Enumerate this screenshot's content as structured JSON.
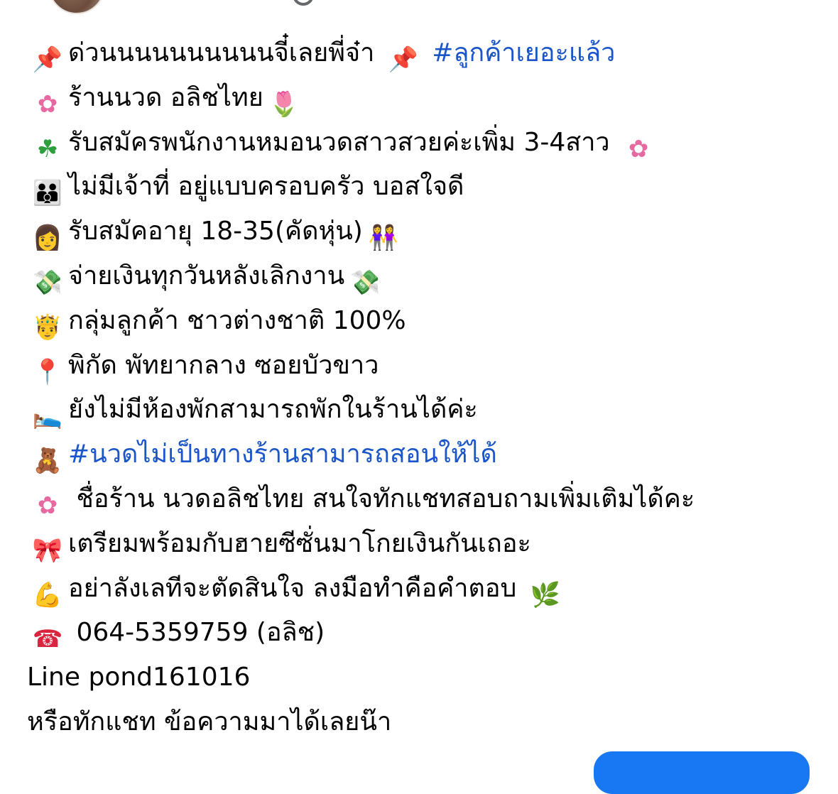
{
  "post": {
    "lines": [
      {
        "icon": "pushpin-icon",
        "glyph": "📌",
        "text": "ด่วนนนนนนนนนนจี๋เลยพี่จ๋า ",
        "icon2": "pushpin-icon",
        "glyph2": "📌",
        "hashtag": "#ลูกค้าเยอะแล้ว"
      },
      {
        "icon": "lotus-icon",
        "glyph": "✿",
        "text": "ร้านนวด อลิชไทย",
        "icon2": "tulip-icon",
        "glyph2": "🌷"
      },
      {
        "icon": "four-leaf-clover-icon",
        "glyph": "☘",
        "text": "รับสมัครพนักงานหมอนวดสาวสวยค่ะเพิ่ม 3-4สาว  ",
        "icon2": "lotus-icon",
        "glyph2": "✿"
      },
      {
        "icon": "family-icon",
        "glyph": "👪",
        "text": "ไม่มีเจ้าที่ อยู่แบบครอบครัว บอสใจดี"
      },
      {
        "icon": "woman-icon",
        "glyph": "👩",
        "text": "รับสมัคอายุ 18-35(คัดหุ่น)",
        "icon2": "two-women-icon",
        "glyph2": "👭"
      },
      {
        "icon": "money-wings-icon",
        "glyph": "💸",
        "text": "จ่ายเงินทุกวันหลังเลิกงาน",
        "icon2": "money-wings-icon",
        "glyph2": "💸"
      },
      {
        "icon": "prince-icon",
        "glyph": "🤴",
        "text": "กลุ่มลูกค้า ชาวต่างชาติ 100%"
      },
      {
        "icon": "round-pushpin-icon",
        "glyph": "📍",
        "text": "พิกัด พัทยากลาง ซอยบัวขาว"
      },
      {
        "icon": "bed-icon",
        "glyph": "🛌",
        "text": "ยังไม่มีห้องพักสามารถพักในร้านได้ค่ะ"
      },
      {
        "icon": "teddy-bear-icon",
        "glyph": "🧸",
        "hashtag": "#นวดไม่เป็นทางร้านสามารถสอนให้ได้"
      },
      {
        "icon": "lotus-icon",
        "glyph": "✿",
        "text": " ชื่อร้าน นวดอลิชไทย สนใจทักแชทสอบถามเพิ่มเติมได้คะ"
      },
      {
        "icon": "ribbon-icon",
        "glyph": "🎀",
        "text": "เตรียมพร้อมกับฮายซีซั่นมาโกยเงินกันเถอะ"
      },
      {
        "icon": "flexed-biceps-icon",
        "glyph": "💪",
        "text": "อย่าลังเลทีจะตัดสินใจ ลงมือทำคือคำตอบ ",
        "icon2": "herb-icon",
        "glyph2": "🌿"
      },
      {
        "icon": "telephone-icon",
        "glyph": "☎",
        "text": " 064-5359759 (อลิช)"
      },
      {
        "text": "Line  pond161016"
      },
      {
        "text": "หรือทักแชท ข้อความมาได้เลยน๊า"
      }
    ]
  },
  "colors": {
    "hashtag": "#1a56c9",
    "button": "#1877f2"
  }
}
